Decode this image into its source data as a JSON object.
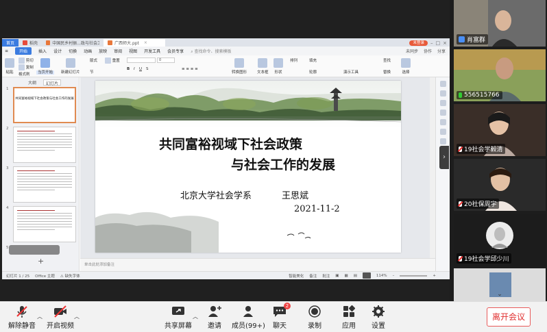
{
  "wps": {
    "tabs": [
      {
        "label": "首页",
        "color": "#3a7be0"
      },
      {
        "label": "稻壳",
        "color": "#e84a3a"
      },
      {
        "label": "中国民乡村振...政与社会工作",
        "color": "#e8773a"
      },
      {
        "label": "广西师大.ppt",
        "color": "#e8773a"
      }
    ],
    "login_label": "未登录",
    "menu": [
      "开始",
      "插入",
      "设计",
      "切换",
      "动画",
      "放映",
      "审阅",
      "视图",
      "开发工具",
      "会员专享"
    ],
    "menu_search": "查找命令、搜索模板",
    "menu_right": [
      "未同步",
      "协作",
      "分享"
    ],
    "ribbon": {
      "paste": "粘贴",
      "cut": "剪切",
      "copy": "复制",
      "format_painter": "格式刷",
      "from_current": "当页开始",
      "new_slide": "新建幻灯片",
      "layout": "版式",
      "section": "节",
      "reset": "重置",
      "font_size": "0",
      "textbox": "文本框",
      "shape": "形状",
      "arrange": "排列",
      "outline": "轮廓",
      "presentation_tool": "演示工具",
      "replace": "替换",
      "find": "查找",
      "select": "选择",
      "convert_smartart": "转换图形",
      "fill": "填充"
    },
    "left_tabs": [
      "大纲",
      "幻灯片"
    ],
    "thumb_numbers": [
      "1",
      "2",
      "3",
      "4",
      "5"
    ],
    "thumb1_title": "共同富裕视域下社会政策与社会工作的发展",
    "slide": {
      "title1": "共同富裕视域下社会政策",
      "title2": "与社会工作的发展",
      "author": "北京大学社会学系",
      "name": "王思斌",
      "date": "2021-11-2"
    },
    "notes_placeholder": "单击此处添加备注",
    "status": {
      "page": "幻灯片 1 / 25",
      "theme": "Office 主题",
      "font_missing": "缺失字体",
      "smart_beautify": "智能美化",
      "notes": "备注",
      "comments": "批注",
      "zoom": "114%"
    }
  },
  "participants": [
    {
      "name": "肖富群",
      "mic": "off",
      "icon": "person-icon"
    },
    {
      "name": "556515766",
      "mic": "on",
      "icon": "phone-icon"
    },
    {
      "name": "19社会学毅清",
      "mic": "off",
      "icon": "mic-icon"
    },
    {
      "name": "20社保周宇",
      "mic": "off",
      "icon": "mic-icon"
    },
    {
      "name": "19社会学邱少川",
      "mic": "off",
      "icon": "mic-icon"
    }
  ],
  "toolbar": {
    "unmute": "解除静音",
    "start_video": "开启视频",
    "share_screen": "共享屏幕",
    "invite": "邀请",
    "members": "成员(99+)",
    "chat": "聊天",
    "chat_badge": "2",
    "record": "录制",
    "apps": "应用",
    "settings": "设置",
    "leave": "离开会议"
  },
  "colors": {
    "accent": "#3a7be0",
    "leave_red": "#e03030",
    "mic_on": "#33cc33"
  }
}
